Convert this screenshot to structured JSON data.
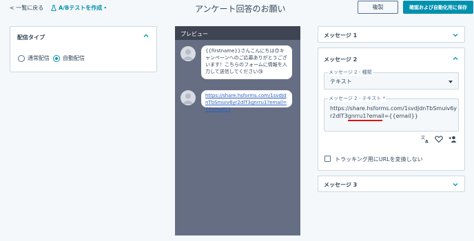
{
  "header": {
    "back_link": "< 一覧に戻る",
    "ab_test_label": "A/Bテストを作成",
    "title": "アンケート回答のお願い",
    "copy_button": "複製",
    "save_button": "確認および自動化用に保存"
  },
  "delivery": {
    "title": "配信タイプ",
    "options": [
      {
        "label": "通常配信",
        "selected": false
      },
      {
        "label": "自動配信",
        "selected": true
      }
    ]
  },
  "preview": {
    "header": "プレビュー",
    "messages": [
      {
        "text": "{{firstname}}さんこんにちは😊キャンペーンへのご応募ありがとうございます！こちらのフォームに情報を入力して送信してください😘"
      },
      {
        "text": "https://share.hsforms.com/1svdJdnTbSmuiv6yr2dlT3gnrru1?email={{email}}"
      }
    ]
  },
  "messages_panel": {
    "message1": {
      "title": "メッセージ 1"
    },
    "message2": {
      "title": "メッセージ 2",
      "type_label": "メッセージ 2 - 種類",
      "type_value": "テキスト",
      "text_label": "メッセージ 2 - テキスト *",
      "text_value": "https://share.hsforms.com/1svdJdnTbSmuiv6yr2dlT3gnrru1?email={{email}}",
      "tracking_label": "トラッキング用にURLを変換しない"
    },
    "message3": {
      "title": "メッセージ 3"
    }
  },
  "colors": {
    "accent": "#0091ae",
    "preview_bg": "#666e84",
    "preview_header": "#3e4452",
    "highlight_underline": "#e01010"
  }
}
